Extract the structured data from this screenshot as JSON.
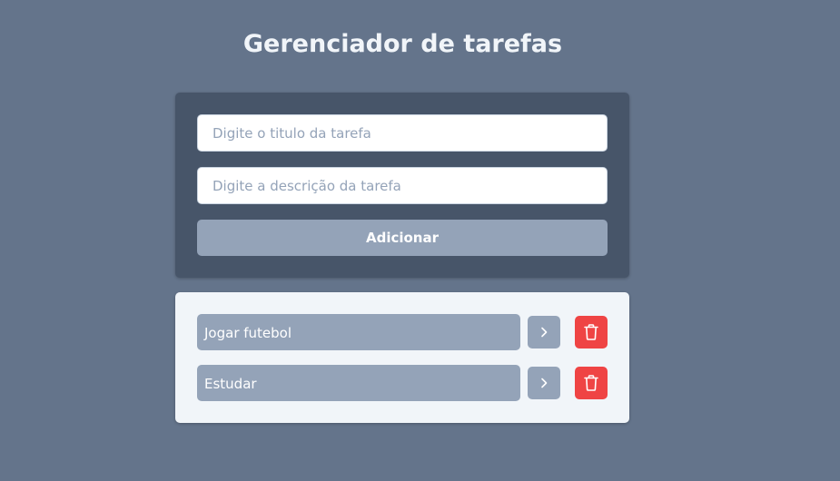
{
  "header": {
    "title": "Gerenciador de tarefas"
  },
  "form": {
    "title_placeholder": "Digite o titulo da tarefa",
    "title_value": "",
    "description_placeholder": "Digite a descrição da tarefa",
    "description_value": "",
    "add_label": "Adicionar"
  },
  "tasks": [
    {
      "title": "Jogar futebol",
      "details_icon": "chevron-right-icon",
      "delete_icon": "trash-icon"
    },
    {
      "title": "Estudar",
      "details_icon": "chevron-right-icon",
      "delete_icon": "trash-icon"
    }
  ],
  "colors": {
    "background": "#64748b",
    "form_card": "#475569",
    "list_card": "#f1f5f9",
    "task_item": "#94a3b8",
    "delete": "#ef4444"
  }
}
